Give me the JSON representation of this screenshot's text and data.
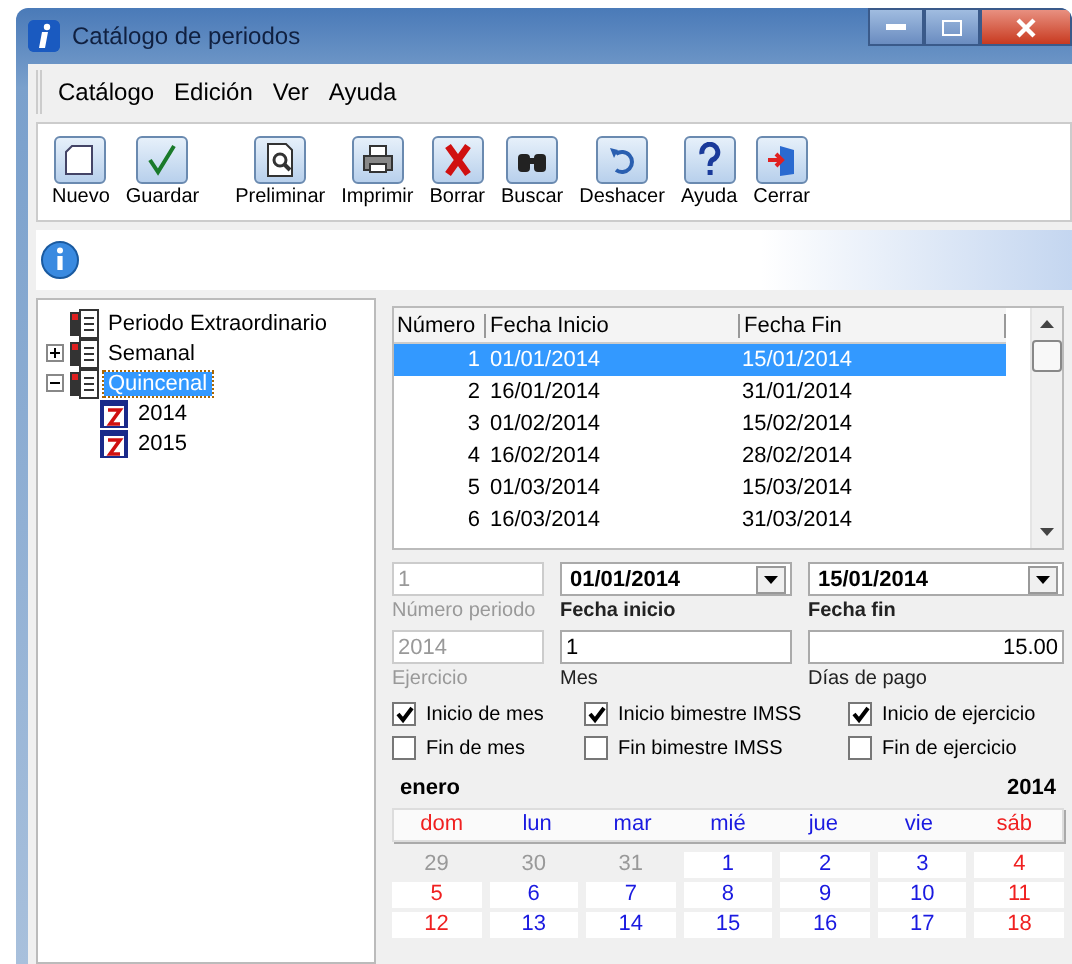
{
  "window": {
    "title": "Catálogo de periodos"
  },
  "menu": [
    "Catálogo",
    "Edición",
    "Ver",
    "Ayuda"
  ],
  "toolbar": [
    {
      "label": "Nuevo"
    },
    {
      "label": "Guardar"
    },
    {
      "label": "Preliminar"
    },
    {
      "label": "Imprimir"
    },
    {
      "label": "Borrar"
    },
    {
      "label": "Buscar"
    },
    {
      "label": "Deshacer"
    },
    {
      "label": "Ayuda"
    },
    {
      "label": "Cerrar"
    }
  ],
  "tree": [
    {
      "label": "Periodo Extraordinario",
      "selected": false
    },
    {
      "label": "Semanal",
      "selected": false,
      "expanded": false
    },
    {
      "label": "Quincenal",
      "selected": true,
      "expanded": true,
      "children": [
        {
          "label": "2014",
          "selected": false
        },
        {
          "label": "2015",
          "selected": false
        }
      ]
    }
  ],
  "table": {
    "columns": [
      "Número",
      "Fecha Inicio",
      "Fecha Fin"
    ],
    "rows": [
      {
        "cells": [
          "1",
          "01/01/2014",
          "15/01/2014"
        ],
        "selected": true
      },
      {
        "cells": [
          "2",
          "16/01/2014",
          "31/01/2014"
        ],
        "selected": false
      },
      {
        "cells": [
          "3",
          "01/02/2014",
          "15/02/2014"
        ],
        "selected": false
      },
      {
        "cells": [
          "4",
          "16/02/2014",
          "28/02/2014"
        ],
        "selected": false
      },
      {
        "cells": [
          "5",
          "01/03/2014",
          "15/03/2014"
        ],
        "selected": false
      },
      {
        "cells": [
          "6",
          "16/03/2014",
          "31/03/2014"
        ],
        "selected": false
      }
    ]
  },
  "fields": [
    {
      "label": "Número periodo",
      "value": "1",
      "disabled": true,
      "kind": "text"
    },
    {
      "label": "Fecha inicio",
      "value": "01/01/2014",
      "disabled": false,
      "kind": "date"
    },
    {
      "label": "Fecha fin",
      "value": "15/01/2014",
      "disabled": false,
      "kind": "date"
    },
    {
      "label": "Ejercicio",
      "value": "2014",
      "disabled": true,
      "kind": "text"
    },
    {
      "label": "Mes",
      "value": "1",
      "disabled": false,
      "kind": "text"
    },
    {
      "label": "Días de pago",
      "value": "15.00",
      "disabled": false,
      "kind": "number"
    }
  ],
  "checkboxes": [
    {
      "label": "Inicio de mes",
      "checked": true
    },
    {
      "label": "Inicio bimestre IMSS",
      "checked": true
    },
    {
      "label": "Inicio de ejercicio",
      "checked": true
    },
    {
      "label": "Fin de mes",
      "checked": false
    },
    {
      "label": "Fin bimestre IMSS",
      "checked": false
    },
    {
      "label": "Fin de ejercicio",
      "checked": false
    }
  ],
  "calendar": {
    "month": "enero",
    "year": "2014",
    "weekdays": [
      {
        "label": "dom",
        "kind": "weekend"
      },
      {
        "label": "lun",
        "kind": "weekday"
      },
      {
        "label": "mar",
        "kind": "weekday"
      },
      {
        "label": "mié",
        "kind": "weekday"
      },
      {
        "label": "jue",
        "kind": "weekday"
      },
      {
        "label": "vie",
        "kind": "weekday"
      },
      {
        "label": "sáb",
        "kind": "weekend"
      }
    ],
    "days": [
      {
        "label": "29",
        "kind": "other"
      },
      {
        "label": "30",
        "kind": "other"
      },
      {
        "label": "31",
        "kind": "other"
      },
      {
        "label": "1",
        "kind": "weekday"
      },
      {
        "label": "2",
        "kind": "weekday"
      },
      {
        "label": "3",
        "kind": "weekday"
      },
      {
        "label": "4",
        "kind": "weekend"
      },
      {
        "label": "5",
        "kind": "weekend"
      },
      {
        "label": "6",
        "kind": "weekday"
      },
      {
        "label": "7",
        "kind": "weekday"
      },
      {
        "label": "8",
        "kind": "weekday"
      },
      {
        "label": "9",
        "kind": "weekday"
      },
      {
        "label": "10",
        "kind": "weekday"
      },
      {
        "label": "11",
        "kind": "weekend"
      },
      {
        "label": "12",
        "kind": "weekend"
      },
      {
        "label": "13",
        "kind": "weekday"
      },
      {
        "label": "14",
        "kind": "weekday"
      },
      {
        "label": "15",
        "kind": "weekday"
      },
      {
        "label": "16",
        "kind": "weekday"
      },
      {
        "label": "17",
        "kind": "weekday"
      },
      {
        "label": "18",
        "kind": "weekend"
      }
    ]
  }
}
